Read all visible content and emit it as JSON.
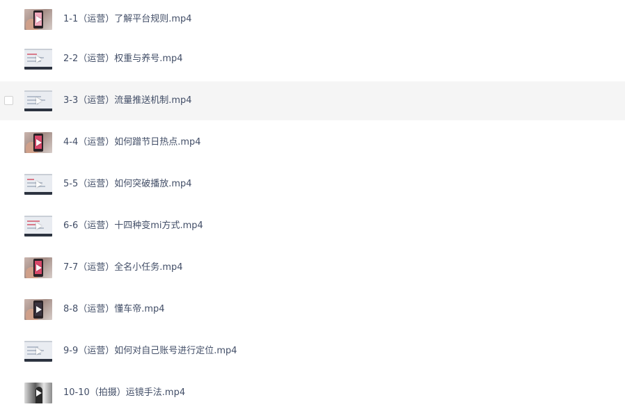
{
  "files": [
    {
      "name": "1-1（运营）了解平台规则.mp4",
      "thumb_icon": "video-thumbnail-icon",
      "hovered": false
    },
    {
      "name": "2-2（运营）权重与养号.mp4",
      "thumb_icon": "video-thumbnail-icon",
      "hovered": false
    },
    {
      "name": "3-3（运营）流量推送机制.mp4",
      "thumb_icon": "video-thumbnail-icon",
      "hovered": true
    },
    {
      "name": "4-4（运营）如何蹭节日热点.mp4",
      "thumb_icon": "video-thumbnail-icon",
      "hovered": false
    },
    {
      "name": "5-5（运营）如何突破播放.mp4",
      "thumb_icon": "video-thumbnail-icon",
      "hovered": false
    },
    {
      "name": "6-6（运营）十四种变mi方式.mp4",
      "thumb_icon": "video-thumbnail-icon",
      "hovered": false
    },
    {
      "name": "7-7（运营）全名小任务.mp4",
      "thumb_icon": "video-thumbnail-icon",
      "hovered": false
    },
    {
      "name": "8-8（运营）懂车帝.mp4",
      "thumb_icon": "video-thumbnail-icon",
      "hovered": false
    },
    {
      "name": "9-9（运营）如何对自己账号进行定位.mp4",
      "thumb_icon": "video-thumbnail-icon",
      "hovered": false
    },
    {
      "name": "10-10（拍摄）运镜手法.mp4",
      "thumb_icon": "video-thumbnail-icon",
      "hovered": false
    }
  ],
  "colors": {
    "file_name_text": "#424e67",
    "hover_row_background": "#f5f5f5",
    "checkbox_border": "#d2d2d2"
  }
}
